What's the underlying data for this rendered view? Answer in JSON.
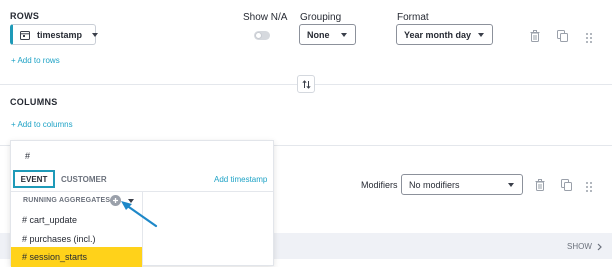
{
  "rows": {
    "section_label": "ROWS",
    "headers": {
      "show_na": "Show N/A",
      "grouping": "Grouping",
      "format": "Format"
    },
    "field": {
      "label": "timestamp",
      "icon": "calendar-icon"
    },
    "grouping_value": "None",
    "format_value": "Year month day",
    "add_link": "+ Add to rows"
  },
  "columns": {
    "section_label": "COLUMNS",
    "add_link": "+ Add to columns"
  },
  "values": {
    "modifiers_label": "Modifiers",
    "modifiers_value": "No modifiers",
    "show_label": "SHOW"
  },
  "dropdown": {
    "search_value": "#",
    "tabs": [
      {
        "label": "EVENT",
        "active": true
      },
      {
        "label": "CUSTOMER",
        "active": false
      }
    ],
    "add_timestamp": "Add timestamp",
    "group_label": "RUNNING AGGREGATES",
    "items": [
      {
        "label": "# cart_update",
        "selected": false
      },
      {
        "label": "# purchases (incl.)",
        "selected": false
      },
      {
        "label": "# session_starts",
        "selected": true
      }
    ]
  },
  "colors": {
    "accent": "#1fa3c6",
    "highlight": "#ffd21a",
    "arrow": "#1e88c8",
    "focus_border": "#1e9ab8"
  },
  "icons": [
    "calendar-icon",
    "chevron-down-icon",
    "trash-icon",
    "copy-icon",
    "drag-handle-icon",
    "swap-icon",
    "plus-circle-icon",
    "chevron-right-icon"
  ]
}
